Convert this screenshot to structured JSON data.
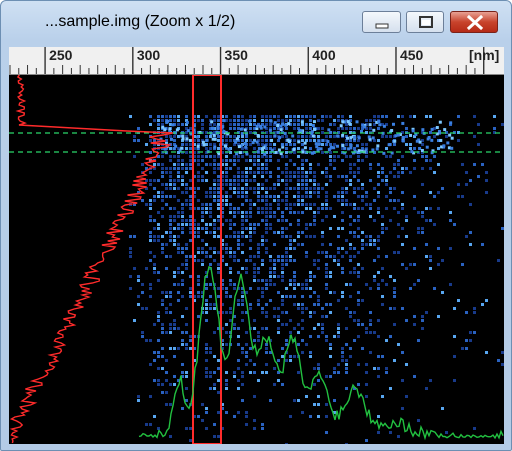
{
  "window": {
    "title": "...sample.img (Zoom x 1/2)",
    "buttons": {
      "minimize": "minimize-icon",
      "maximize": "maximize-icon",
      "close": "close-icon"
    }
  },
  "ruler": {
    "unit": "[nm]",
    "major_ticks": [
      {
        "label": "250",
        "value": 250
      },
      {
        "label": "300",
        "value": 300
      },
      {
        "label": "350",
        "value": 350
      },
      {
        "label": "400",
        "value": 400
      },
      {
        "label": "450",
        "value": 450
      }
    ],
    "range_nm": [
      230,
      500
    ]
  },
  "spectrum": {
    "colors": {
      "background": "#000000",
      "intensity_low": "#0a1a60",
      "intensity_high": "#2e7bd6",
      "vertical_profile": "#ff2b2b",
      "horizontal_profile": "#22c040",
      "selection_box": "#ff2b2b",
      "guide_lines": "#2bd66a"
    },
    "selection_band_nm": [
      327,
      343
    ]
  }
}
